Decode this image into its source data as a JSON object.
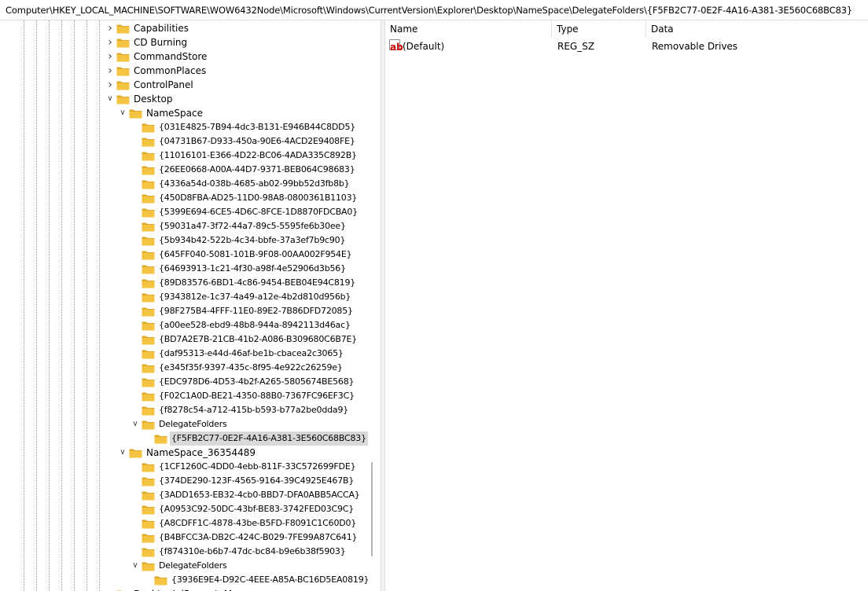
{
  "address_bar": {
    "path": "Computer\\HKEY_LOCAL_MACHINE\\SOFTWARE\\WOW6432Node\\Microsoft\\Windows\\CurrentVersion\\Explorer\\Desktop\\NameSpace\\DelegateFolders\\{F5FB2C77-0E2F-4A16-A381-3E560C68BC83}"
  },
  "tree": {
    "items": [
      {
        "label": "Capabilities"
      },
      {
        "label": "CD Burning"
      },
      {
        "label": "CommandStore"
      },
      {
        "label": "CommonPlaces"
      },
      {
        "label": "ControlPanel"
      },
      {
        "label": "Desktop"
      },
      {
        "label": "NameSpace"
      },
      {
        "label": "{031E4825-7B94-4dc3-B131-E946B44C8DD5}"
      },
      {
        "label": "{04731B67-D933-450a-90E6-4ACD2E9408FE}"
      },
      {
        "label": "{11016101-E366-4D22-BC06-4ADA335C892B}"
      },
      {
        "label": "{26EE0668-A00A-44D7-9371-BEB064C98683}"
      },
      {
        "label": "{4336a54d-038b-4685-ab02-99bb52d3fb8b}"
      },
      {
        "label": "{450D8FBA-AD25-11D0-98A8-0800361B1103}"
      },
      {
        "label": "{5399E694-6CE5-4D6C-8FCE-1D8870FDCBA0}"
      },
      {
        "label": "{59031a47-3f72-44a7-89c5-5595fe6b30ee}"
      },
      {
        "label": "{5b934b42-522b-4c34-bbfe-37a3ef7b9c90}"
      },
      {
        "label": "{645FF040-5081-101B-9F08-00AA002F954E}"
      },
      {
        "label": "{64693913-1c21-4f30-a98f-4e52906d3b56}"
      },
      {
        "label": "{89D83576-6BD1-4c86-9454-BEB04E94C819}"
      },
      {
        "label": "{9343812e-1c37-4a49-a12e-4b2d810d956b}"
      },
      {
        "label": "{98F275B4-4FFF-11E0-89E2-7B86DFD72085}"
      },
      {
        "label": "{a00ee528-ebd9-48b8-944a-8942113d46ac}"
      },
      {
        "label": "{BD7A2E7B-21CB-41b2-A086-B309680C6B7E}"
      },
      {
        "label": "{daf95313-e44d-46af-be1b-cbacea2c3065}"
      },
      {
        "label": "{e345f35f-9397-435c-8f95-4e922c26259e}"
      },
      {
        "label": "{EDC978D6-4D53-4b2f-A265-5805674BE568}"
      },
      {
        "label": "{F02C1A0D-BE21-4350-88B0-7367FC96EF3C}"
      },
      {
        "label": "{f8278c54-a712-415b-b593-b77a2be0dda9}"
      },
      {
        "label": "DelegateFolders"
      },
      {
        "label": "{F5FB2C77-0E2F-4A16-A381-3E560C68BC83}"
      },
      {
        "label": "NameSpace_36354489"
      },
      {
        "label": "{1CF1260C-4DD0-4ebb-811F-33C572699FDE}"
      },
      {
        "label": "{374DE290-123F-4565-9164-39C4925E467B}"
      },
      {
        "label": "{3ADD1653-EB32-4cb0-BBD7-DFA0ABB5ACCA}"
      },
      {
        "label": "{A0953C92-50DC-43bf-BE83-3742FED03C9C}"
      },
      {
        "label": "{A8CDFF1C-4878-43be-B5FD-F8091C1C60D0}"
      },
      {
        "label": "{B4BFCC3A-DB2C-424C-B029-7FE99A87C641}"
      },
      {
        "label": "{f874310e-b6b7-47dc-bc84-b9e6b38f5903}"
      },
      {
        "label": "DelegateFolders"
      },
      {
        "label": "{3936E9E4-D92C-4EEE-A85A-BC16D5EA0819}"
      },
      {
        "label": "DesktopIniPropertyMap"
      }
    ]
  },
  "values_pane": {
    "columns": {
      "name": "Name",
      "type": "Type",
      "data": "Data"
    },
    "rows": [
      {
        "name": "(Default)",
        "type": "REG_SZ",
        "data": "Removable Drives",
        "icon": "string-value-icon"
      }
    ]
  },
  "colors": {
    "folder": "#f5c342",
    "folder_dark": "#e2a827",
    "selection": "#d9d9d9"
  }
}
